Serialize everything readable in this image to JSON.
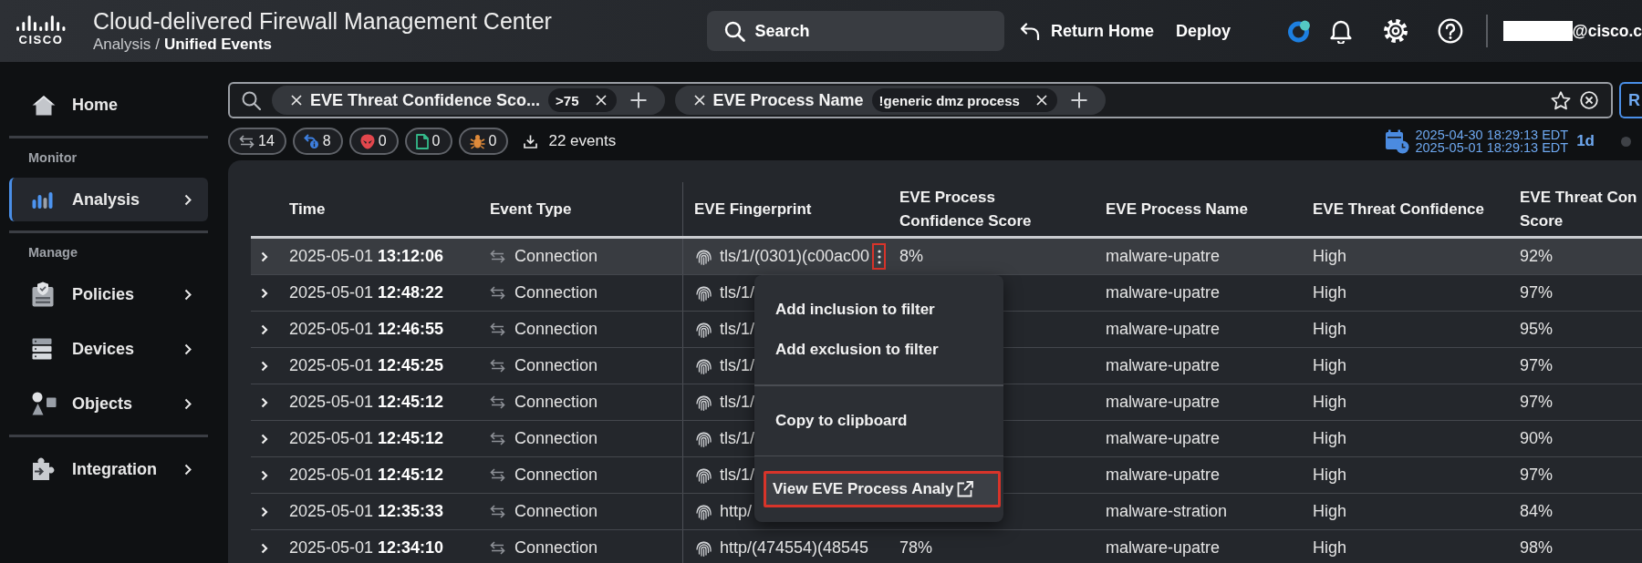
{
  "header": {
    "logo_text": "CISCO",
    "title": "Cloud-delivered Firewall Management Center",
    "breadcrumb": [
      {
        "label": "Analysis",
        "current": false
      },
      {
        "label": "Unified Events",
        "current": true
      }
    ],
    "breadcrumb_separator": "/",
    "search": {
      "label": "Search"
    },
    "actions": [
      {
        "kind": "return",
        "label": "Return Home"
      },
      {
        "kind": "plain",
        "label": "Deploy"
      }
    ],
    "user": {
      "redacted": true,
      "email": "@cisco.c"
    }
  },
  "sidebar": {
    "groups": [
      {
        "items": [
          {
            "kind": "home",
            "label": "Home",
            "selected": false,
            "expandable": false
          }
        ]
      },
      {
        "heading": "Monitor",
        "items": [
          {
            "kind": "analysis",
            "label": "Analysis",
            "selected": true,
            "expandable": true
          }
        ]
      },
      {
        "heading": "Manage",
        "items": [
          {
            "kind": "policies",
            "label": "Policies",
            "selected": false,
            "expandable": true
          },
          {
            "kind": "devices",
            "label": "Devices",
            "selected": false,
            "expandable": true
          },
          {
            "kind": "objects",
            "label": "Objects",
            "selected": false,
            "expandable": true
          }
        ]
      },
      {
        "items": [
          {
            "kind": "integration",
            "label": "Integration",
            "selected": false,
            "expandable": true
          }
        ]
      }
    ]
  },
  "filters": {
    "chips": [
      {
        "field": "EVE Threat Confidence Sco...",
        "value": ">75"
      },
      {
        "field": "EVE Process Name",
        "value": "!generic dmz process"
      }
    ],
    "action_label": "R"
  },
  "counters": [
    {
      "kind": "connection",
      "count": "14"
    },
    {
      "kind": "intrusion",
      "count": "8"
    },
    {
      "kind": "threat",
      "count": "0"
    },
    {
      "kind": "file",
      "count": "0"
    },
    {
      "kind": "malware",
      "count": "0"
    }
  ],
  "events_total": "22 events",
  "time_range": {
    "start": "2025-04-30 18:29:13 EDT",
    "end": "2025-05-01 18:29:13 EDT",
    "preset": "1d"
  },
  "table": {
    "columns": [
      "Time",
      "Event Type",
      "EVE Fingerprint",
      "EVE Process Confidence Score",
      "EVE Process Name",
      "EVE Threat Confidence",
      "EVE Threat Con Score"
    ],
    "rows": [
      {
        "selected": true,
        "menu_open": true,
        "time": "2025-05-01 **13:12:06**",
        "event_type": "Connection",
        "fingerprint": "tls/1/(0301)(c00ac00",
        "process_score": "8%",
        "process_name": "malware-upatre",
        "threat_confidence": "High",
        "threat_score": "92%"
      },
      {
        "selected": false,
        "menu_open": false,
        "time": "2025-05-01 **12:48:22**",
        "event_type": "Connection",
        "fingerprint": "tls/1/",
        "process_name": "malware-upatre",
        "threat_confidence": "High",
        "threat_score": "97%"
      },
      {
        "selected": false,
        "menu_open": false,
        "time": "2025-05-01 **12:46:55**",
        "event_type": "Connection",
        "fingerprint": "tls/1/",
        "process_name": "malware-upatre",
        "threat_confidence": "High",
        "threat_score": "95%"
      },
      {
        "selected": false,
        "menu_open": false,
        "time": "2025-05-01 **12:45:25**",
        "event_type": "Connection",
        "fingerprint": "tls/1/",
        "process_name": "malware-upatre",
        "threat_confidence": "High",
        "threat_score": "97%"
      },
      {
        "selected": false,
        "menu_open": false,
        "time": "2025-05-01 **12:45:12**",
        "event_type": "Connection",
        "fingerprint": "tls/1/",
        "process_name": "malware-upatre",
        "threat_confidence": "High",
        "threat_score": "97%"
      },
      {
        "selected": false,
        "menu_open": false,
        "time": "2025-05-01 **12:45:12**",
        "event_type": "Connection",
        "fingerprint": "tls/1/",
        "process_name": "malware-upatre",
        "threat_confidence": "High",
        "threat_score": "90%"
      },
      {
        "selected": false,
        "menu_open": false,
        "time": "2025-05-01 **12:45:12**",
        "event_type": "Connection",
        "fingerprint": "tls/1/",
        "process_name": "malware-upatre",
        "threat_confidence": "High",
        "threat_score": "97%"
      },
      {
        "selected": false,
        "menu_open": false,
        "time": "2025-05-01 **12:35:33**",
        "event_type": "Connection",
        "fingerprint": "http/",
        "process_name": "malware-stration",
        "threat_confidence": "High",
        "threat_score": "84%"
      },
      {
        "selected": false,
        "menu_open": false,
        "time": "2025-05-01 **12:34:10**",
        "event_type": "Connection",
        "fingerprint": "http/(474554)(48545",
        "process_score": "78%",
        "process_name": "malware-upatre",
        "threat_confidence": "High",
        "threat_score": "98%"
      }
    ]
  },
  "context_menu": {
    "sections": [
      {
        "items": [
          {
            "label": "Add inclusion to filter",
            "highlighted": false,
            "external": false
          },
          {
            "label": "Add exclusion to filter",
            "highlighted": false,
            "external": false
          }
        ]
      },
      {
        "items": [
          {
            "label": "Copy to clipboard",
            "highlighted": false,
            "external": false
          }
        ]
      },
      {
        "items": [
          {
            "label": "View EVE Process Analy",
            "highlighted": true,
            "external": true
          }
        ]
      }
    ]
  }
}
